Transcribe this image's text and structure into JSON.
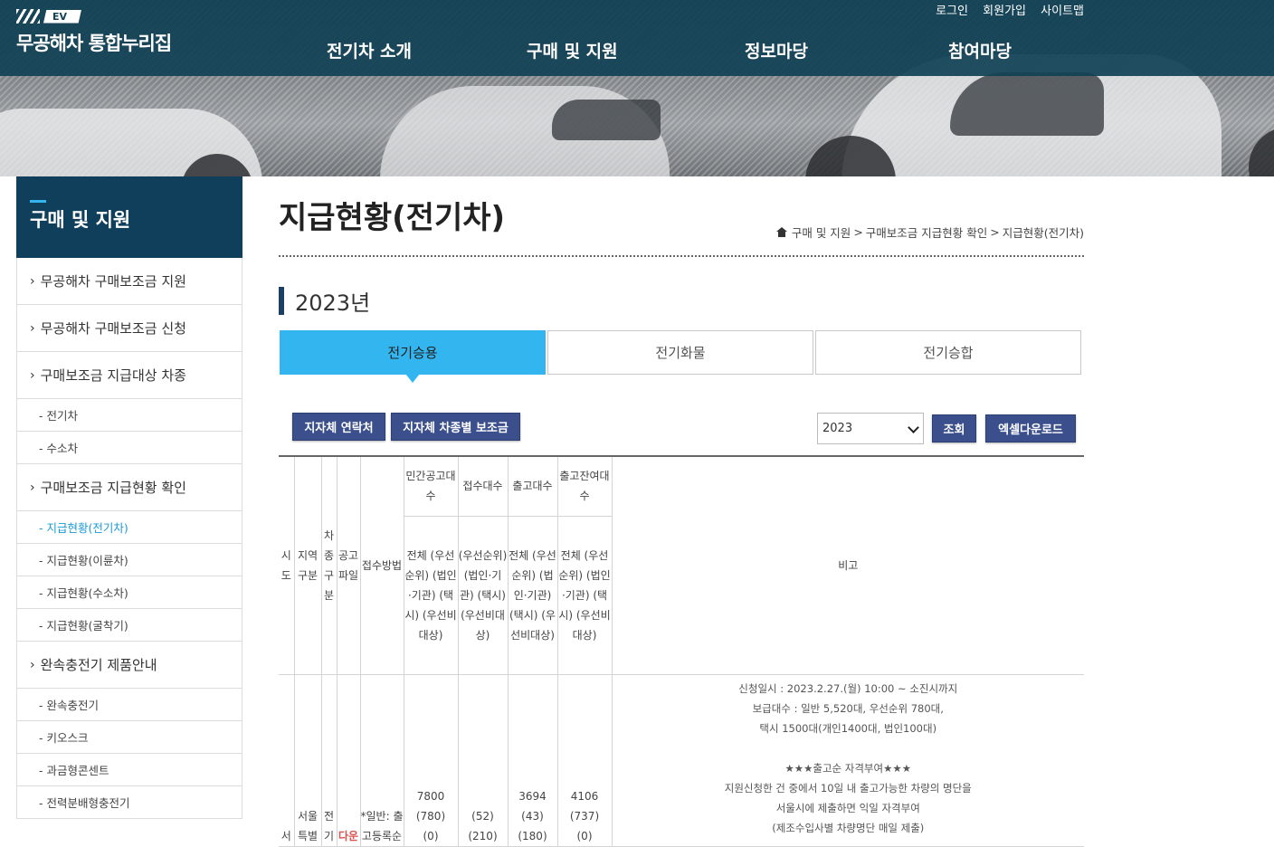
{
  "site": {
    "logo_mark": "EV",
    "logo_text": "무공해차 통합누리집",
    "util_links": [
      "로그인",
      "회원가입",
      "사이트맵"
    ],
    "gnb": [
      "전기차 소개",
      "구매 및 지원",
      "정보마당",
      "참여마당"
    ]
  },
  "sidebar": {
    "title": "구매 및 지원",
    "items": [
      {
        "label": "무공해차 구매보조금 지원",
        "level": 1
      },
      {
        "label": "무공해차 구매보조금 신청",
        "level": 1
      },
      {
        "label": "구매보조금 지급대상 차종",
        "level": 1
      },
      {
        "label": "- 전기차",
        "level": 2
      },
      {
        "label": "- 수소차",
        "level": 2
      },
      {
        "label": "구매보조금 지급현황 확인",
        "level": 1
      },
      {
        "label": "- 지급현황(전기차)",
        "level": 2,
        "active": true
      },
      {
        "label": "- 지급현황(이륜차)",
        "level": 2
      },
      {
        "label": "- 지급현황(수소차)",
        "level": 2
      },
      {
        "label": "- 지급현황(굴착기)",
        "level": 2
      },
      {
        "label": "완속충전기 제품안내",
        "level": 1
      },
      {
        "label": "- 완속충전기",
        "level": 2
      },
      {
        "label": "- 키오스크",
        "level": 2
      },
      {
        "label": "- 과금형콘센트",
        "level": 2
      },
      {
        "label": "- 전력분배형충전기",
        "level": 2
      }
    ]
  },
  "page": {
    "title": "지급현황(전기차)",
    "breadcrumb": [
      "구매 및 지원",
      "구매보조금 지급현황 확인",
      "지급현황(전기차)"
    ],
    "year_heading": "2023년"
  },
  "tabs": [
    {
      "label": "전기승용",
      "active": true
    },
    {
      "label": "전기화물",
      "active": false
    },
    {
      "label": "전기승합",
      "active": false
    }
  ],
  "buttons": {
    "contacts": "지자체 연락처",
    "subsidy_by_model": "지자체 차종별 보조금",
    "search": "조회",
    "excel": "엑셀다운로드"
  },
  "year_select": {
    "value": "2023"
  },
  "table": {
    "headers": {
      "sido": "시도",
      "region": "지역구분",
      "car_type": "차종구분",
      "notice_file": "공고파일",
      "method": "접수방법",
      "notice_count": "민간공고대수",
      "received": "접수대수",
      "released": "출고대수",
      "remaining": "출고잔여대수",
      "note": "비고",
      "sub_notice": "전체 (우선순위) (법인·기관) (택시) (우선비대상)",
      "sub_received": "(우선순위) (법인·기관) (택시) (우선비대상)",
      "sub_released": "전체 (우선순위) (법인·기관) (택시) (우선비대상)",
      "sub_remaining": "전체 (우선순위) (법인·기관) (택시) (우선비대상)"
    },
    "row": {
      "sido": "서",
      "region": "서울특별",
      "car_type": "전기",
      "file_link": "다운",
      "method": "*일반: 출고등록순",
      "notice": [
        "7800",
        "(780)",
        "(0)"
      ],
      "received": [
        "",
        "(52)",
        "(210)"
      ],
      "released": [
        "3694",
        "(43)",
        "(180)"
      ],
      "remaining": [
        "4106",
        "(737)",
        "(0)"
      ],
      "note_lines": [
        "신청일시 : 2023.2.27.(월) 10:00 ~ 소진시까지",
        "보급대수 : 일반 5,520대, 우선순위 780대,",
        "택시 1500대(개인1400대, 법인100대)",
        "",
        "★★★출고순 자격부여★★★",
        "지원신청한 건 중에서 10일 내 출고가능한 차량의 명단을",
        "서울시에 제출하면 익일 자격부여",
        "(제조수입사별 차량명단 매일 제출)"
      ]
    }
  },
  "colors": {
    "header_bg": "#124256",
    "side_head_bg": "#0f3f5a",
    "tab_active": "#33b6f0",
    "button_bg": "#3a4f8c",
    "active_link": "#1a9ad6"
  }
}
